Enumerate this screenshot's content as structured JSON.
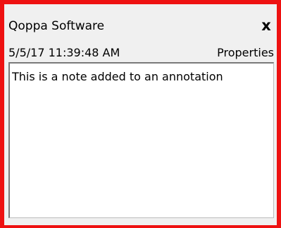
{
  "note": {
    "author": "Qoppa Software",
    "close_label": "x",
    "timestamp": "5/5/17 11:39:48 AM",
    "properties_label": "Properties",
    "text": "This is a note added to an annotation"
  },
  "colors": {
    "border": "#ee1111",
    "panel_background": "#f0f0f0",
    "text_area_background": "#ffffff"
  }
}
